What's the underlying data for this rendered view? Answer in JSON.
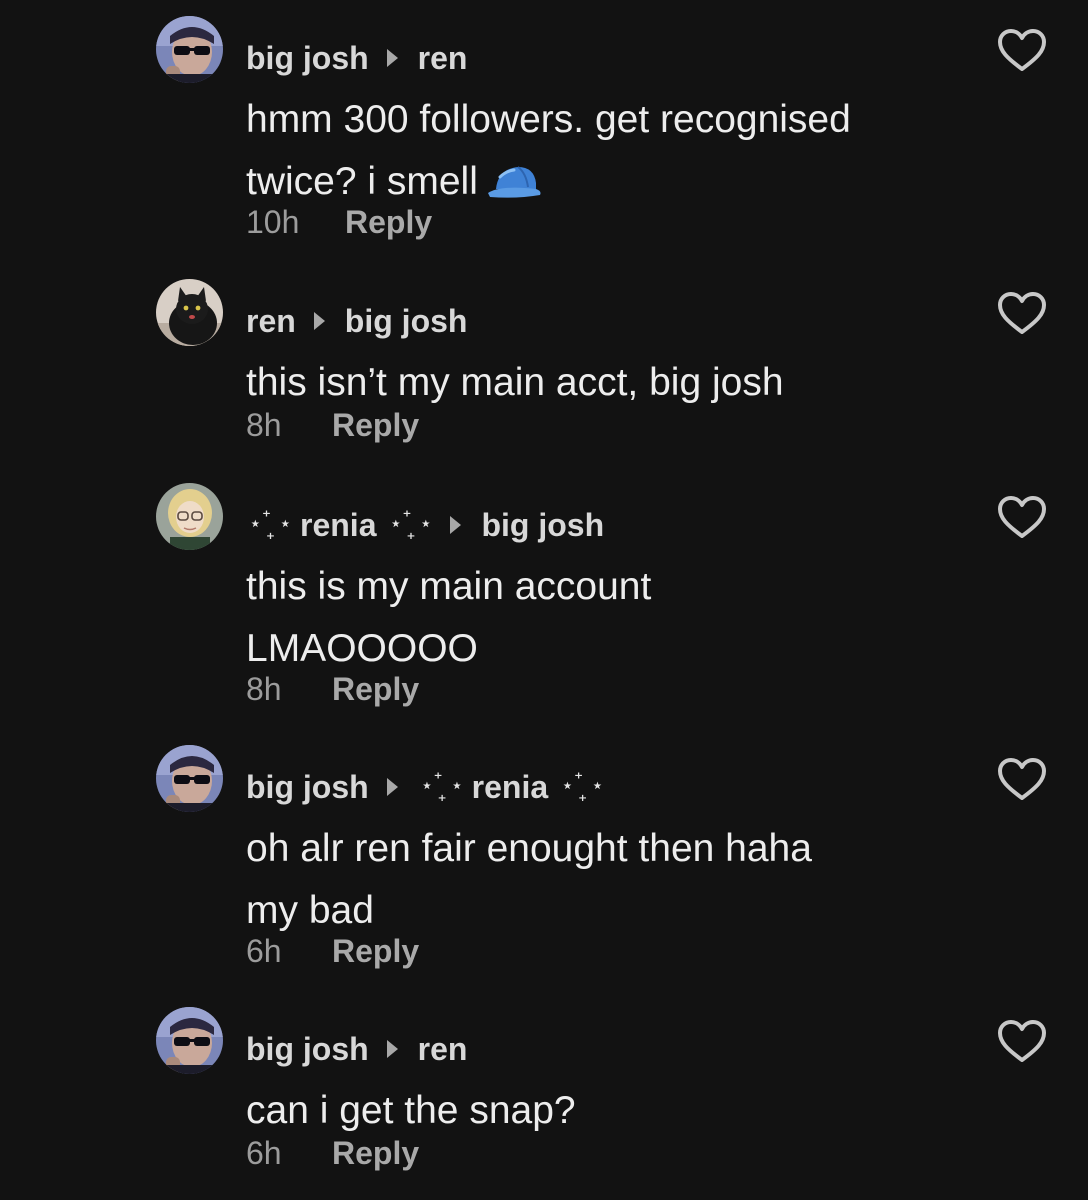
{
  "comments": [
    {
      "author": "big josh",
      "reply_to": "ren",
      "text": "hmm 300 followers. get recognised twice? i smell",
      "emoji": "blue-cap-emoji",
      "time": "10h",
      "reply_label": "Reply",
      "avatar": "person-sunglasses-avatar"
    },
    {
      "author": "ren",
      "reply_to": "big josh",
      "text": "this isn’t my main acct, big josh",
      "time": "8h",
      "reply_label": "Reply",
      "avatar": "black-cat-avatar"
    },
    {
      "author": "renia",
      "reply_to": "big josh",
      "text_line1": "this is my main account",
      "text_line2": "LMAOOOOO",
      "time": "8h",
      "reply_label": "Reply",
      "avatar": "blonde-glasses-avatar",
      "sparkle": "⋆⁺₊⋆"
    },
    {
      "author": "big josh",
      "reply_to": "renia",
      "text_line1": "oh alr ren fair enought then haha",
      "text_line2": "my bad",
      "time": "6h",
      "reply_label": "Reply",
      "avatar": "person-sunglasses-avatar"
    },
    {
      "author": "big josh",
      "reply_to": "ren",
      "text": "can i get the snap?",
      "time": "6h",
      "reply_label": "Reply",
      "avatar": "person-sunglasses-avatar"
    }
  ],
  "colors": {
    "background": "#121212",
    "username": "#d8d8d8",
    "body_text": "#ededed",
    "meta_text": "#9c9c9c",
    "heart_outline": "#c8c8c8"
  }
}
